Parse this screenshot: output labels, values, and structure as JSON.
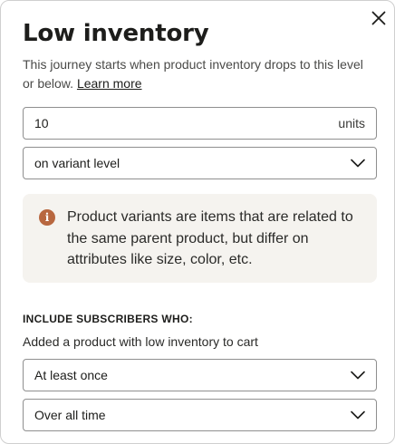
{
  "dialog": {
    "title": "Low inventory",
    "description": "This journey starts when product inventory drops to this level or below.",
    "learn_more": "Learn more"
  },
  "threshold": {
    "value": "10",
    "unit": "units"
  },
  "level_select": {
    "selected": "on variant level"
  },
  "info": {
    "icon": "info-icon",
    "text": "Product variants are items that are related to the same parent product, but differ on attributes like size, color, etc."
  },
  "subscribers": {
    "heading": "INCLUDE SUBSCRIBERS WHO:",
    "condition": "Added a product with low inventory to cart",
    "frequency_selected": "At least once",
    "timeframe_selected": "Over all time"
  },
  "icons": {
    "close": "close-icon",
    "chevron": "chevron-down-icon"
  },
  "colors": {
    "info_icon": "#b8673f",
    "info_background": "#f5f3ef"
  }
}
